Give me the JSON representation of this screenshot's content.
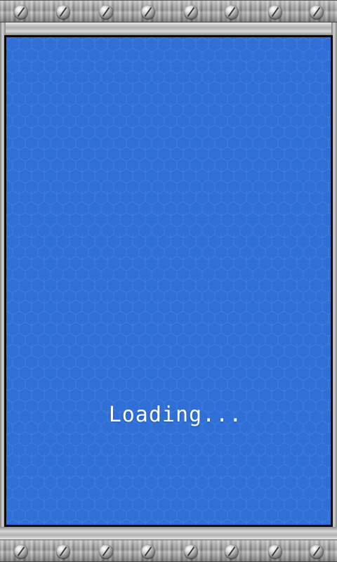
{
  "screen": {
    "loading_label": "Loading..."
  },
  "colors": {
    "play_area_background": "#2f6fd6",
    "hex_line": "#5a8fe6",
    "text": "#ffffff",
    "frame_border": "#0b0b0b"
  },
  "icons": {
    "screw": "screw-icon"
  }
}
